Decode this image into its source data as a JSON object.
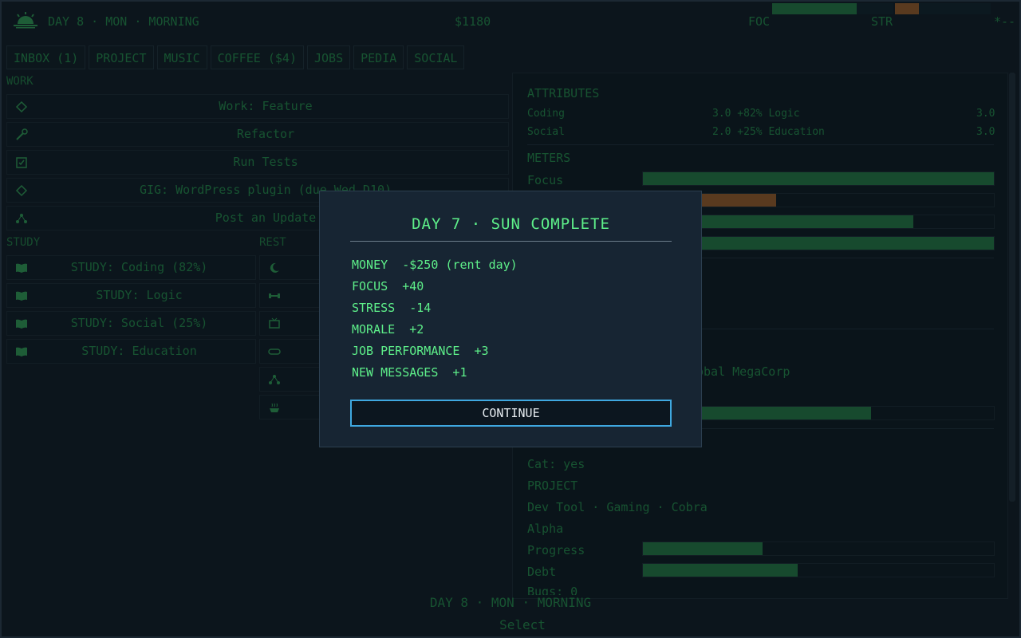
{
  "topbar": {
    "day": "DAY 8 · MON · MORNING",
    "money": "$1180",
    "foc_label": "FOC",
    "str_label": "STR",
    "extra_label": "*--",
    "icon": "sunrise-icon",
    "foc_level": 0.7,
    "str_level": 0.25
  },
  "tabs": [
    "INBOX (1)",
    "PROJECT",
    "MUSIC",
    "COFFEE ($4)",
    "JOBS",
    "PEDIA",
    "SOCIAL"
  ],
  "work": {
    "label": "WORK",
    "items": [
      {
        "label": "Work: Feature",
        "icon": "diamond-icon"
      },
      {
        "label": "Refactor",
        "icon": "wrench-icon"
      },
      {
        "label": "Run Tests",
        "icon": "checkbox-icon"
      },
      {
        "label": "GIG: WordPress plugin (due Wed D10)",
        "icon": "diamond-icon"
      },
      {
        "label": "Post an Update",
        "icon": "share-icon"
      }
    ]
  },
  "study": {
    "label": "STUDY",
    "items": [
      {
        "label": "STUDY: Coding (82%)",
        "icon": "book-icon"
      },
      {
        "label": "STUDY: Logic",
        "icon": "book-icon"
      },
      {
        "label": "STUDY: Social (25%)",
        "icon": "book-icon"
      },
      {
        "label": "STUDY: Education",
        "icon": "book-icon"
      }
    ]
  },
  "rest": {
    "label": "REST",
    "icons": [
      "moon-icon",
      "dumbbell-icon",
      "tv-icon",
      "gamepad-icon",
      "share-icon",
      "bath-icon"
    ]
  },
  "right": {
    "attributes_heading": "ATTRIBUTES",
    "attributes": [
      {
        "name": "Coding",
        "detail": "3.0 +82% Logic",
        "value": "3.0"
      },
      {
        "name": "Social",
        "detail": "2.0 +25% Education",
        "value": "3.0"
      }
    ],
    "meters_heading": "METERS",
    "meters": [
      {
        "name": "Focus",
        "level": 1.0,
        "color": "#1f6b3b"
      },
      {
        "name": "",
        "level": 0.38,
        "color": "#8a5222"
      },
      {
        "name": "",
        "level": 0.77,
        "color": "#1f6b3b"
      },
      {
        "name": "",
        "level": 1.0,
        "color": "#1f6b3b"
      }
    ],
    "employer_text": "obal MegaCorp",
    "employer_level": 0.65,
    "cat_text": "Cat: yes",
    "project_heading": "PROJECT",
    "project_desc": "Dev Tool · Gaming · Cobra",
    "project_name": "Alpha",
    "progress_label": "Progress",
    "progress_level": 0.34,
    "debt_label": "Debt",
    "debt_level": 0.44,
    "cut_text": "Bugs: 0"
  },
  "bottom": {
    "day": "DAY 8 · MON · MORNING",
    "select": "Select"
  },
  "modal": {
    "title": "DAY 7 · SUN COMPLETE",
    "lines": [
      "MONEY  -$250 (rent day)",
      "FOCUS  +40",
      "STRESS  -14",
      "MORALE  +2",
      "JOB PERFORMANCE  +3",
      "NEW MESSAGES  +1"
    ],
    "button": "CONTINUE"
  },
  "colors": {
    "accent_green": "#5ef08a",
    "button_border": "#3fa8e0",
    "stress_orange": "#8a5222",
    "bar_green": "#1f6b3b"
  }
}
